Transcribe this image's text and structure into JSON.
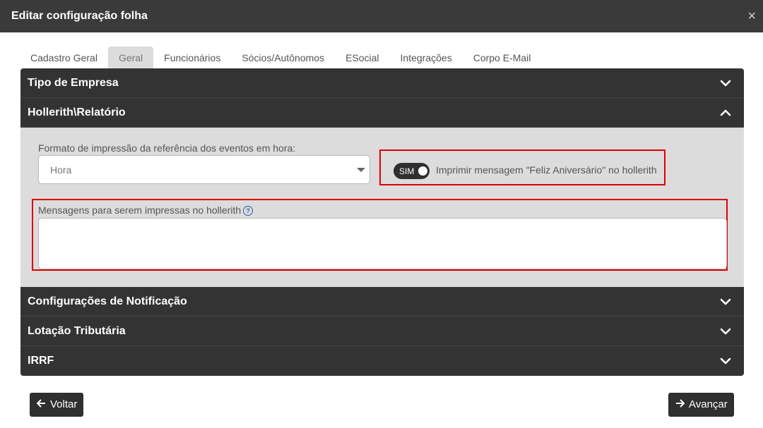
{
  "dialog": {
    "title": "Editar configuração folha",
    "close_symbol": "×"
  },
  "tabs": [
    {
      "label": "Cadastro Geral",
      "active": false
    },
    {
      "label": "Geral",
      "active": true
    },
    {
      "label": "Funcionários",
      "active": false
    },
    {
      "label": "Sócios/Autônomos",
      "active": false
    },
    {
      "label": "ESocial",
      "active": false
    },
    {
      "label": "Integrações",
      "active": false
    },
    {
      "label": "Corpo E-Mail",
      "active": false
    }
  ],
  "sections": [
    {
      "label": "Tipo de Empresa",
      "expanded": false,
      "icon": "chevron-down-icon"
    },
    {
      "label": "Hollerith\\Relatório",
      "expanded": true,
      "icon": "chevron-up-icon"
    },
    {
      "label": "Configurações de Notificação",
      "expanded": false,
      "icon": "chevron-down-icon"
    },
    {
      "label": "Lotação Tributária",
      "expanded": false,
      "icon": "chevron-down-icon"
    },
    {
      "label": "IRRF",
      "expanded": false,
      "icon": "chevron-down-icon"
    }
  ],
  "hollerith": {
    "format_label": "Formato de impressão da referência dos eventos em hora:",
    "format_value": "Hora",
    "toggle_label": "SIM",
    "toggle_on": true,
    "toggle_text": "Imprimir mensagem \"Feliz Aniversário\" no hollerith",
    "messages_label": "Mensagens para serem impressas no hollerith",
    "help_symbol": "?",
    "messages_value": ""
  },
  "footer": {
    "back_label": "Voltar",
    "next_label": "Avançar",
    "back_icon": "arrow-left-icon",
    "next_icon": "arrow-right-icon"
  },
  "colors": {
    "header_bg": "#333333",
    "highlight": "#e00000",
    "body_bg": "#dcdcdc"
  }
}
